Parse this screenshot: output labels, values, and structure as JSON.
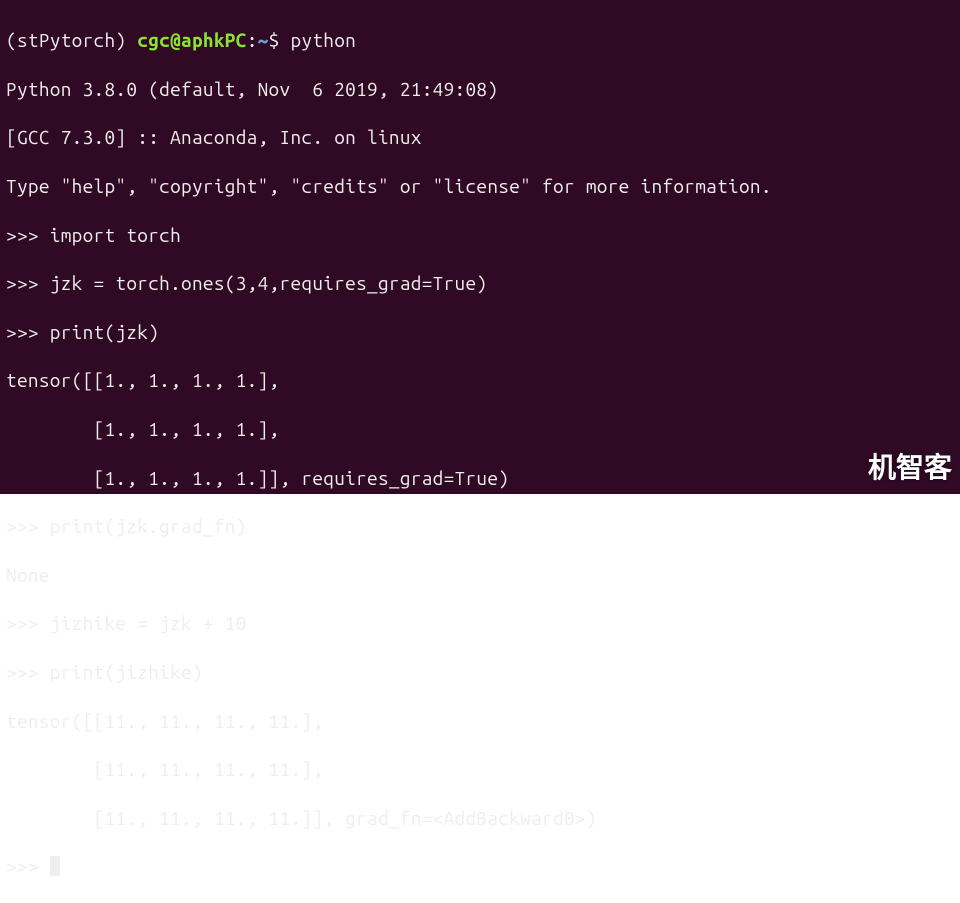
{
  "shell": {
    "env_prefix": "(stPytorch) ",
    "user_host": "cgc@aphkPC",
    "colon": ":",
    "path": "~",
    "dollar": "$ ",
    "command": "python"
  },
  "lines": {
    "l1": "Python 3.8.0 (default, Nov  6 2019, 21:49:08)",
    "l2": "[GCC 7.3.0] :: Anaconda, Inc. on linux",
    "l3": "Type \"help\", \"copyright\", \"credits\" or \"license\" for more information."
  },
  "repl": {
    "prompt": ">>> ",
    "r1": "import torch",
    "r2": "jzk = torch.ones(3,4,requires_grad=True)",
    "r3": "print(jzk)",
    "o3a": "tensor([[1., 1., 1., 1.],",
    "o3b": "        [1., 1., 1., 1.],",
    "o3c": "        [1., 1., 1., 1.]], requires_grad=True)",
    "r4": "print(jzk.grad_fn)",
    "o4": "None",
    "r5": "jizhike = jzk + 10",
    "r6": "print(jizhike)",
    "o6a": "tensor([[11., 11., 11., 11.],",
    "o6b": "        [11., 11., 11., 11.],",
    "o6c": "        [11., 11., 11., 11.]], grad_fn=<AddBackward0>)"
  },
  "watermark": "机智客"
}
